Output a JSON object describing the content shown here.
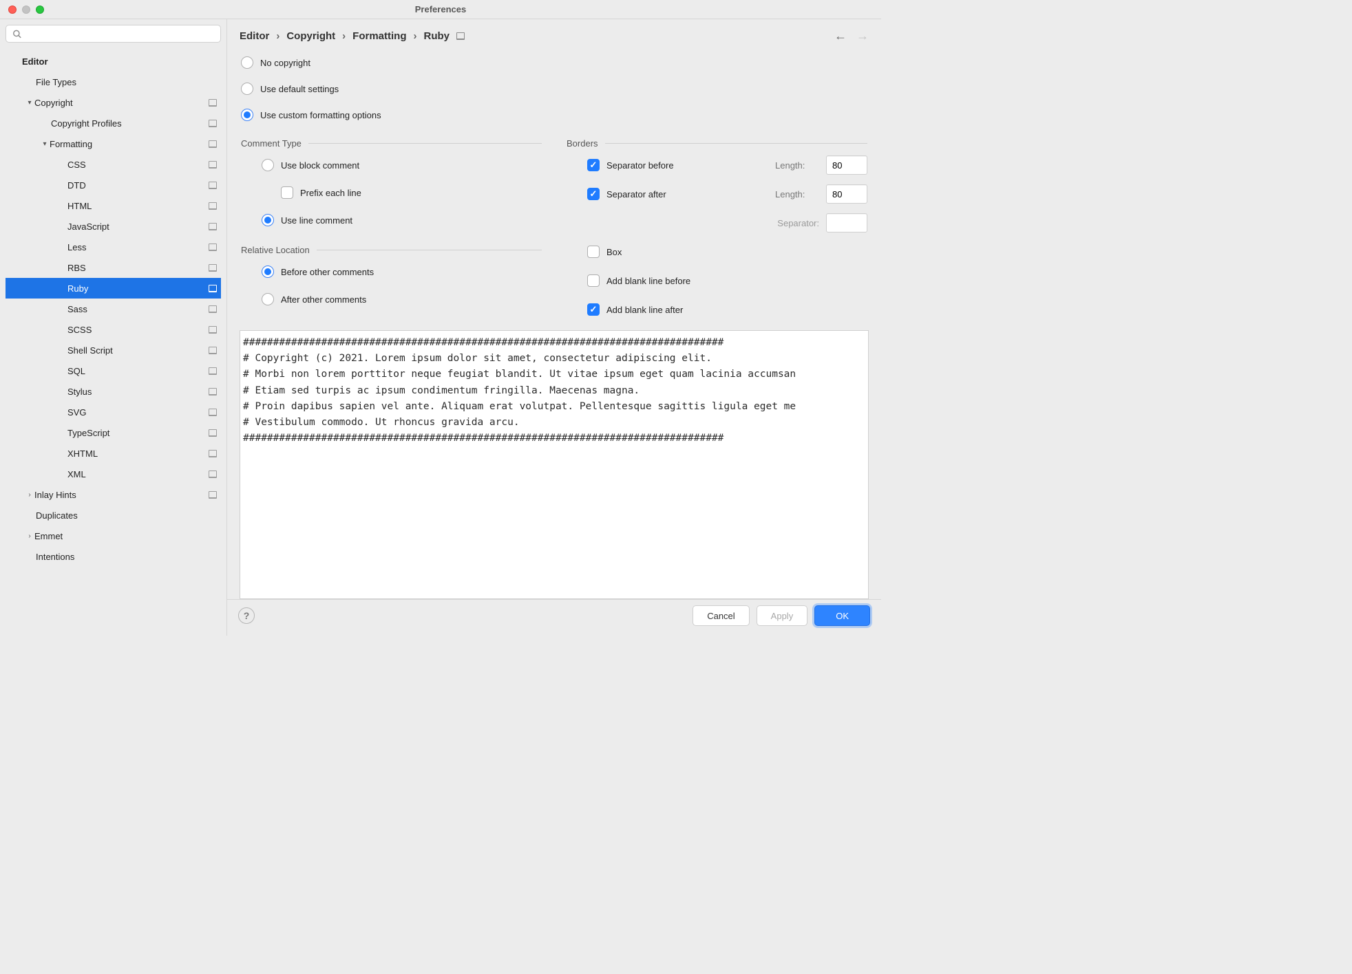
{
  "window": {
    "title": "Preferences"
  },
  "search": {
    "placeholder": ""
  },
  "tree": [
    {
      "label": "Editor",
      "level": 0,
      "bold": true,
      "arrow": "",
      "selected": false,
      "hasarrow": false,
      "badge": false
    },
    {
      "label": "File Types",
      "level": 1,
      "bold": false,
      "arrow": "",
      "selected": false,
      "hasarrow": false,
      "badge": false
    },
    {
      "label": "Copyright",
      "level": 1,
      "bold": false,
      "arrow": "v",
      "selected": false,
      "hasarrow": true,
      "badge": true
    },
    {
      "label": "Copyright Profiles",
      "level": 2,
      "bold": false,
      "arrow": "",
      "selected": false,
      "hasarrow": false,
      "badge": true
    },
    {
      "label": "Formatting",
      "level": 2,
      "bold": false,
      "arrow": "v",
      "selected": false,
      "hasarrow": true,
      "badge": true
    },
    {
      "label": "CSS",
      "level": 3,
      "bold": false,
      "arrow": "",
      "selected": false,
      "hasarrow": false,
      "badge": true
    },
    {
      "label": "DTD",
      "level": 3,
      "bold": false,
      "arrow": "",
      "selected": false,
      "hasarrow": false,
      "badge": true
    },
    {
      "label": "HTML",
      "level": 3,
      "bold": false,
      "arrow": "",
      "selected": false,
      "hasarrow": false,
      "badge": true
    },
    {
      "label": "JavaScript",
      "level": 3,
      "bold": false,
      "arrow": "",
      "selected": false,
      "hasarrow": false,
      "badge": true
    },
    {
      "label": "Less",
      "level": 3,
      "bold": false,
      "arrow": "",
      "selected": false,
      "hasarrow": false,
      "badge": true
    },
    {
      "label": "RBS",
      "level": 3,
      "bold": false,
      "arrow": "",
      "selected": false,
      "hasarrow": false,
      "badge": true
    },
    {
      "label": "Ruby",
      "level": 3,
      "bold": false,
      "arrow": "",
      "selected": true,
      "hasarrow": false,
      "badge": true
    },
    {
      "label": "Sass",
      "level": 3,
      "bold": false,
      "arrow": "",
      "selected": false,
      "hasarrow": false,
      "badge": true
    },
    {
      "label": "SCSS",
      "level": 3,
      "bold": false,
      "arrow": "",
      "selected": false,
      "hasarrow": false,
      "badge": true
    },
    {
      "label": "Shell Script",
      "level": 3,
      "bold": false,
      "arrow": "",
      "selected": false,
      "hasarrow": false,
      "badge": true
    },
    {
      "label": "SQL",
      "level": 3,
      "bold": false,
      "arrow": "",
      "selected": false,
      "hasarrow": false,
      "badge": true
    },
    {
      "label": "Stylus",
      "level": 3,
      "bold": false,
      "arrow": "",
      "selected": false,
      "hasarrow": false,
      "badge": true
    },
    {
      "label": "SVG",
      "level": 3,
      "bold": false,
      "arrow": "",
      "selected": false,
      "hasarrow": false,
      "badge": true
    },
    {
      "label": "TypeScript",
      "level": 3,
      "bold": false,
      "arrow": "",
      "selected": false,
      "hasarrow": false,
      "badge": true
    },
    {
      "label": "XHTML",
      "level": 3,
      "bold": false,
      "arrow": "",
      "selected": false,
      "hasarrow": false,
      "badge": true
    },
    {
      "label": "XML",
      "level": 3,
      "bold": false,
      "arrow": "",
      "selected": false,
      "hasarrow": false,
      "badge": true
    },
    {
      "label": "Inlay Hints",
      "level": 1,
      "bold": false,
      "arrow": ">",
      "selected": false,
      "hasarrow": true,
      "badge": true
    },
    {
      "label": "Duplicates",
      "level": 1,
      "bold": false,
      "arrow": "",
      "selected": false,
      "hasarrow": false,
      "badge": false
    },
    {
      "label": "Emmet",
      "level": 1,
      "bold": false,
      "arrow": ">",
      "selected": false,
      "hasarrow": true,
      "badge": false
    },
    {
      "label": "Intentions",
      "level": 1,
      "bold": false,
      "arrow": "",
      "selected": false,
      "hasarrow": false,
      "badge": false
    }
  ],
  "breadcrumb": [
    "Editor",
    "Copyright",
    "Formatting",
    "Ruby"
  ],
  "mode": {
    "no_copyright": "No copyright",
    "use_default": "Use default settings",
    "use_custom": "Use custom formatting options",
    "selected": "use_custom"
  },
  "comment_type": {
    "title": "Comment Type",
    "block": "Use block comment",
    "prefix": "Prefix each line",
    "line": "Use line comment",
    "selected": "line",
    "prefix_checked": false
  },
  "relative": {
    "title": "Relative Location",
    "before": "Before other comments",
    "after": "After other comments",
    "selected": "before"
  },
  "borders": {
    "title": "Borders",
    "sep_before": "Separator before",
    "sep_after": "Separator after",
    "length_label": "Length:",
    "len_before": "80",
    "len_after": "80",
    "separator_label": "Separator:",
    "separator_value": "",
    "box": "Box",
    "blank_before": "Add blank line before",
    "blank_after": "Add blank line after",
    "sep_before_checked": true,
    "sep_after_checked": true,
    "box_checked": false,
    "blank_before_checked": false,
    "blank_after_checked": true
  },
  "preview": "################################################################################\n# Copyright (c) 2021. Lorem ipsum dolor sit amet, consectetur adipiscing elit.\n# Morbi non lorem porttitor neque feugiat blandit. Ut vitae ipsum eget quam lacinia accumsan\n# Etiam sed turpis ac ipsum condimentum fringilla. Maecenas magna.\n# Proin dapibus sapien vel ante. Aliquam erat volutpat. Pellentesque sagittis ligula eget me\n# Vestibulum commodo. Ut rhoncus gravida arcu.\n################################################################################",
  "buttons": {
    "cancel": "Cancel",
    "apply": "Apply",
    "ok": "OK"
  }
}
